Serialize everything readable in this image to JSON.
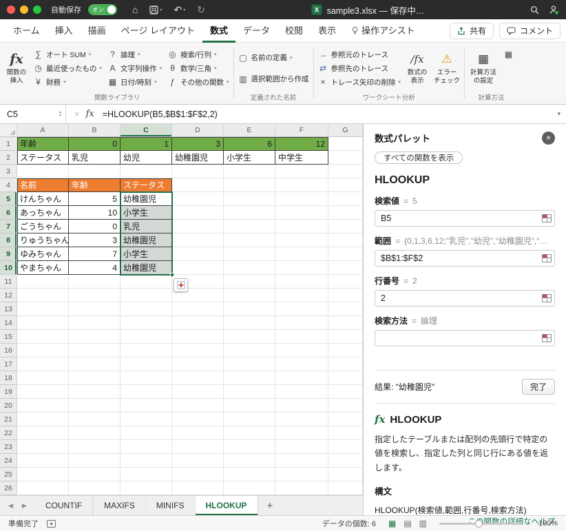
{
  "colors": {
    "accent": "#217346",
    "green-fill": "#70AD47",
    "orange-fill": "#ED7D31",
    "selection": "#1E7145",
    "titlebar-bg": "#2B2B2B"
  },
  "icons": {
    "home": "⌂",
    "undo": "↶",
    "redo": "↻",
    "chevron": "▾",
    "sigma": "∑",
    "clock": "◷",
    "finance": "¥",
    "logic": "?",
    "text-ops": "A",
    "calendar": "▦",
    "lookup": "◎",
    "math": "θ",
    "more-fns": "ƒ",
    "fx": "fx",
    "define-name": "▢",
    "from-selection": "▥",
    "trace-precedents": "→",
    "trace-dependents": "⇄",
    "remove-arrows": "×",
    "show-formulas": "∕fx",
    "error-check": "⚠",
    "calc-settings": "▦",
    "calc-now": "▦",
    "close": "×",
    "cancel": "×",
    "stepper-up": "▴",
    "stepper-down": "▾",
    "nav-prev": "◀",
    "nav-next": "▶",
    "add-sheet": "+",
    "view-normal": "▦",
    "view-page-layout": "▤",
    "view-page-break": "▥",
    "expand-formula-bar": "▾"
  },
  "titlebar": {
    "autosave_label": "自動保存",
    "autosave_state": "オン",
    "doc_title": "sample3.xlsx — 保存中…"
  },
  "ribbon_tabs": {
    "items": [
      {
        "label": "ホーム"
      },
      {
        "label": "挿入"
      },
      {
        "label": "描画"
      },
      {
        "label": "ページ レイアウト"
      },
      {
        "label": "数式"
      },
      {
        "label": "データ"
      },
      {
        "label": "校閲"
      },
      {
        "label": "表示"
      },
      {
        "label": "操作アシスト"
      }
    ],
    "share": "共有",
    "comments": "コメント"
  },
  "ribbon": {
    "insert_function": "関数の挿入",
    "function_library": {
      "label": "関数ライブラリ",
      "items": [
        "オート SUM",
        "最近使ったもの",
        "財務",
        "論理",
        "文字列操作",
        "日付/時刻",
        "検索/行列",
        "数学/三角",
        "その他の関数"
      ]
    },
    "defined_names": {
      "label": "定義された名前",
      "items": [
        "名前の定義",
        "選択範囲から作成"
      ]
    },
    "analysis": {
      "label": "ワークシート分析",
      "items": [
        "参照元のトレース",
        "参照先のトレース",
        "トレース矢印の削除"
      ],
      "show_formulas": "数式の表示",
      "error_check": "エラー チェック"
    },
    "calculation": {
      "label": "計算方法",
      "settings": "計算方法の設定"
    }
  },
  "formula_bar": {
    "name_box": "C5",
    "formula": "=HLOOKUP(B5,$B$1:$F$2,2)"
  },
  "sheet": {
    "col_headers": [
      "A",
      "B",
      "C",
      "D",
      "E",
      "F",
      "G"
    ],
    "rows_visible": 26,
    "lookup_table": {
      "start_row": 1,
      "rows": [
        [
          "年齢",
          "0",
          "1",
          "3",
          "6",
          "12"
        ],
        [
          "ステータス",
          "乳児",
          "幼児",
          "幼稚園児",
          "小学生",
          "中学生"
        ]
      ]
    },
    "people_table": {
      "header_row": 4,
      "headers": [
        "名前",
        "年齢",
        "ステータス"
      ],
      "rows": [
        [
          "けんちゃん",
          "5",
          "幼稚園児"
        ],
        [
          "あっちゃん",
          "10",
          "小学生"
        ],
        [
          "ごうちゃん",
          "0",
          "乳児"
        ],
        [
          "りゅうちゃん",
          "3",
          "幼稚園児"
        ],
        [
          "ゆみちゃん",
          "7",
          "小学生"
        ],
        [
          "やまちゃん",
          "4",
          "幼稚園児"
        ]
      ]
    },
    "selection": {
      "range": "C5:C10",
      "active_cell": "C5",
      "selected_col": "C",
      "selected_rows": [
        5,
        6,
        7,
        8,
        9,
        10
      ]
    }
  },
  "palette": {
    "title": "数式パレット",
    "show_all_button": "すべての関数を表示",
    "function_name": "HLOOKUP",
    "fields": [
      {
        "label": "検索値",
        "eq": "=",
        "preview": "5",
        "value": "B5"
      },
      {
        "label": "範囲",
        "eq": "=",
        "preview": "{0,1,3,6,12;\"乳児\",\"幼児\",\"幼稚園児\",\"…",
        "value": "$B$1:$F$2"
      },
      {
        "label": "行番号",
        "eq": "=",
        "preview": "2",
        "value": "2"
      },
      {
        "label": "検索方法",
        "eq": "=",
        "preview": "論理",
        "value": ""
      }
    ],
    "result": "結果: \"幼稚園児\"",
    "done_button": "完了",
    "help_fx": "fx",
    "help_name": "HLOOKUP",
    "description": "指定したテーブルまたは配列の先頭行で特定の値を検索し、指定した列と同じ行にある値を返します。",
    "syntax_label": "構文",
    "syntax": "HLOOKUP(検索値,範囲,行番号,検索方法)",
    "help_link": "この関数の詳細なヘルプ"
  },
  "sheet_tabs": {
    "items": [
      {
        "label": "COUNTIF"
      },
      {
        "label": "MAXIFS"
      },
      {
        "label": "MINIFS"
      },
      {
        "label": "HLOOKUP"
      }
    ]
  },
  "status_bar": {
    "ready": "準備完了",
    "count": "データの個数: 6",
    "zoom": "100%"
  }
}
